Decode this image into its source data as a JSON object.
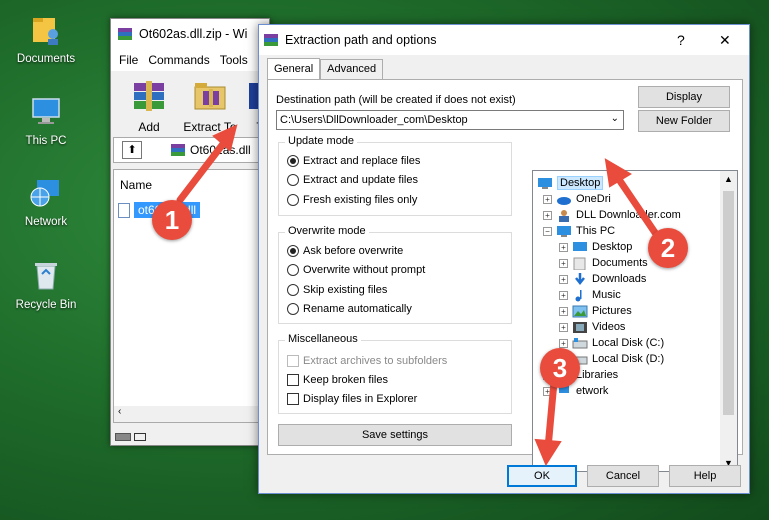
{
  "desktop": {
    "icons": [
      {
        "label": "Documents",
        "icon": "folder-user-icon"
      },
      {
        "label": "This PC",
        "icon": "computer-icon"
      },
      {
        "label": "Network",
        "icon": "network-globe-icon"
      },
      {
        "label": "Recycle Bin",
        "icon": "recycle-bin-icon"
      }
    ]
  },
  "winrar": {
    "title": "Ot602as.dll.zip - Wi",
    "menu": [
      "File",
      "Commands",
      "Tools"
    ],
    "toolbar": {
      "add": "Add",
      "extract_to": "Extract To",
      "partial": "T"
    },
    "path": "Ot602as.dll",
    "path_display": "Ot602as.dll",
    "column_name": "Name",
    "file": "ot602as.dll",
    "file_display": "ot602as.dll"
  },
  "dialog": {
    "title": "Extraction path and options",
    "help_symbol": "?",
    "close_symbol": "✕",
    "tabs": {
      "general": "General",
      "advanced": "Advanced"
    },
    "destination_label": "Destination path (will be created if does not exist)",
    "destination_value": "C:\\Users\\DllDownloader_com\\Desktop",
    "buttons": {
      "display": "Display",
      "new_folder": "New Folder",
      "save_settings": "Save settings",
      "ok": "OK",
      "cancel": "Cancel",
      "help": "Help"
    },
    "update_mode": {
      "label": "Update mode",
      "options": [
        "Extract and replace files",
        "Extract and update files",
        "Fresh existing files only"
      ],
      "selected": 0
    },
    "overwrite_mode": {
      "label": "Overwrite mode",
      "options": [
        "Ask before overwrite",
        "Overwrite without prompt",
        "Skip existing files",
        "Rename automatically"
      ],
      "selected": 0
    },
    "misc": {
      "label": "Miscellaneous",
      "options": [
        "Extract archives to subfolders",
        "Keep broken files",
        "Display files in Explorer"
      ],
      "disabled": [
        true,
        false,
        false
      ]
    },
    "tree": [
      {
        "label": "Desktop",
        "selected": true
      },
      {
        "label": "OneDrive",
        "display": "OneDri"
      },
      {
        "label": "DLL Downloader.com"
      },
      {
        "label": "This PC"
      },
      {
        "label": "Desktop"
      },
      {
        "label": "Documents"
      },
      {
        "label": "Downloads"
      },
      {
        "label": "Music"
      },
      {
        "label": "Pictures"
      },
      {
        "label": "Videos"
      },
      {
        "label": "Local Disk (C:)"
      },
      {
        "label": "Local Disk (D:)"
      },
      {
        "label": "Libraries"
      },
      {
        "label": "Network",
        "display": "etwork"
      }
    ]
  },
  "annotations": {
    "steps": [
      "1",
      "2",
      "3"
    ],
    "color": "#e94b3c"
  }
}
